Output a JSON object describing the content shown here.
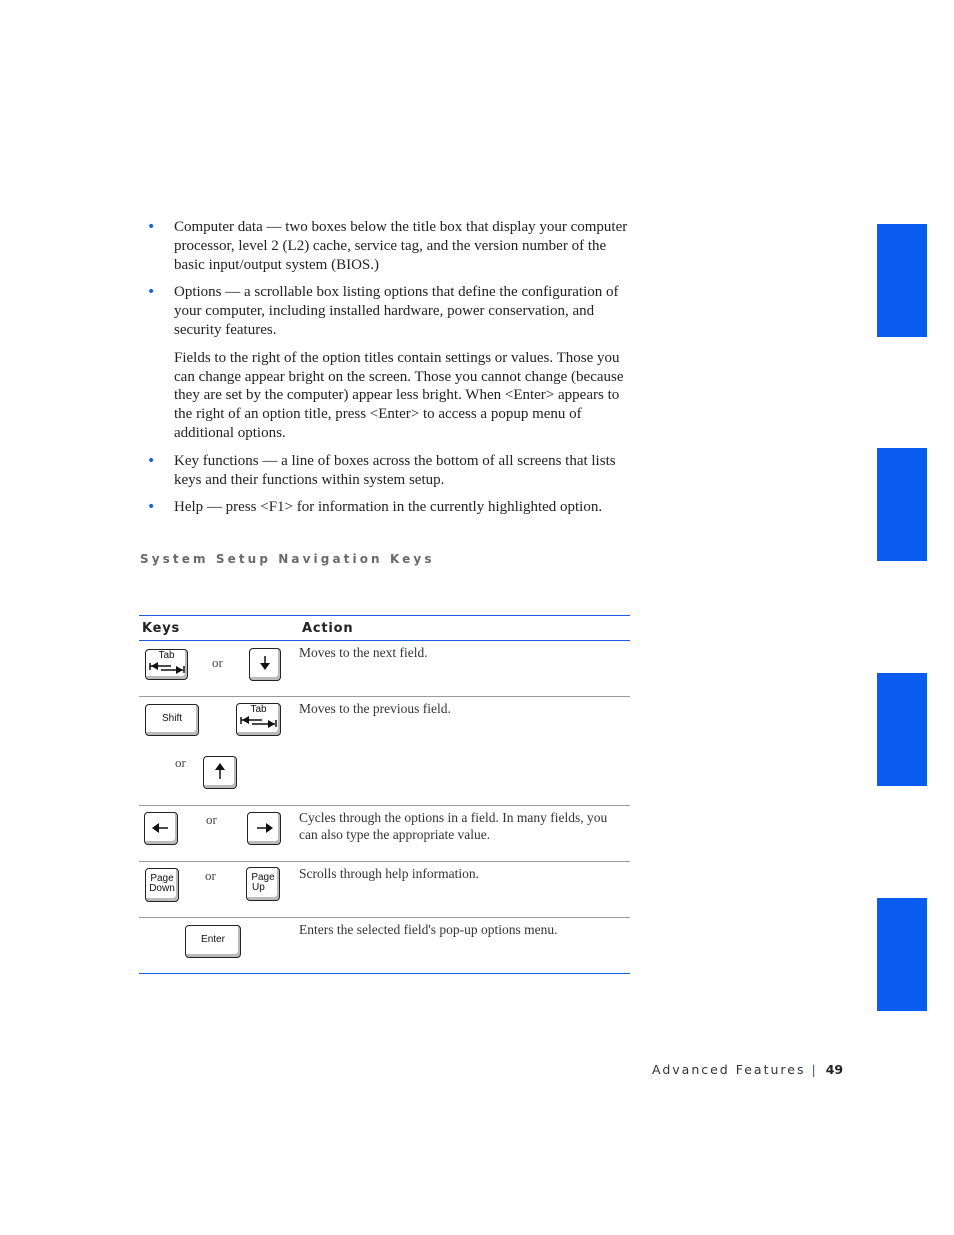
{
  "bullets": [
    {
      "text": "Computer data — two boxes below the title box that display your computer processor, level 2 (L2) cache, service tag, and the version number of the basic input/output system (BIOS.)"
    },
    {
      "text": "Options — a scrollable box listing options that define the configuration of your computer, including installed hardware, power conservation, and security features."
    },
    {
      "text": "Key functions — a line of boxes across the bottom of all screens that lists keys and their functions within system setup."
    },
    {
      "text": "Help — press <F1> for information in the currently highlighted option."
    }
  ],
  "options_paragraph": "Fields to the right of the option titles contain settings or values. Those you can change appear bright on the screen. Those you cannot change (because they are set by the computer) appear less bright. When <Enter> appears to the right of an option title, press <Enter> to access a popup menu of additional options.",
  "section_title": "System Setup Navigation Keys",
  "table": {
    "headers": {
      "keys": "Keys",
      "action": "Action"
    },
    "or_label": "or",
    "rows": [
      {
        "keys": [
          "Tab",
          "Down Arrow"
        ],
        "action": "Moves to the next field."
      },
      {
        "keys": [
          "Shift+Tab",
          "Up Arrow"
        ],
        "action": "Moves to the previous field."
      },
      {
        "keys": [
          "Left Arrow",
          "Right Arrow"
        ],
        "action": "Cycles through the options in a field. In many fields, you can also type the appropriate value."
      },
      {
        "keys": [
          "Page Down",
          "Page Up"
        ],
        "action": "Scrolls through help information."
      },
      {
        "keys": [
          "Enter"
        ],
        "action": "Enters the selected field's pop-up options menu."
      }
    ],
    "key_labels": {
      "tab": "Tab",
      "shift": "Shift",
      "page": "Page",
      "down": "Down",
      "up": "Up",
      "enter": "Enter"
    }
  },
  "footer": {
    "section": "Advanced Features",
    "separator": "|",
    "page_number": "49"
  },
  "colors": {
    "accent": "#0a5cf0"
  }
}
